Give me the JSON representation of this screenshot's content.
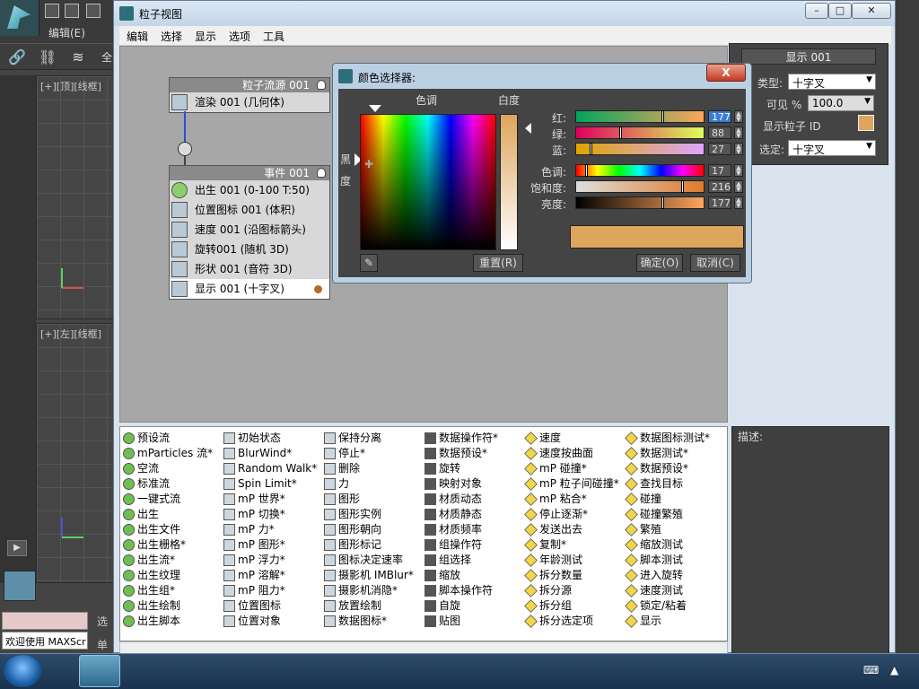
{
  "max": {
    "menu_edit": "编辑(E)",
    "viewport_top_label": "[+][顶][线框]",
    "viewport_left_label": "[+][左][线框]",
    "welcome": "欢迎使用 MAXScr",
    "status_field": "",
    "right_labels": {
      "select_stub": "选",
      "single_stub": "单"
    },
    "toolbar_stub": "全"
  },
  "particle_view": {
    "title": "粒子视图",
    "menu": [
      "编辑",
      "选择",
      "显示",
      "选项",
      "工具"
    ],
    "source_node": {
      "header": "粒子流源 001",
      "ops": [
        "渲染 001 (几何体)"
      ]
    },
    "event_node": {
      "header": "事件 001",
      "ops": [
        "出生 001 (0-100 T:50)",
        "位置图标 001 (体积)",
        "速度 001 (沿图标箭头)",
        "旋转001 (随机 3D)",
        "形状 001 (音符 3D)",
        "显示 001 (十字叉)"
      ]
    },
    "depot": {
      "col1": [
        "预设流",
        "mParticles 流*",
        "空流",
        "标准流",
        "一键式流",
        "出生",
        "出生文件",
        "出生栅格*",
        "出生流*",
        "出生纹理",
        "出生组*",
        "出生绘制",
        "出生脚本"
      ],
      "col2": [
        "初始状态",
        "BlurWind*",
        "Random Walk*",
        "Spin Limit*",
        "mP 世界*",
        "mP 切换*",
        "mP 力*",
        "mP 图形*",
        "mP 浮力*",
        "mP 溶解*",
        "mP 阻力*",
        "位置图标",
        "位置对象"
      ],
      "col3": [
        "保持分离",
        "停止*",
        "删除",
        "力",
        "图形",
        "图形实例",
        "图形朝向",
        "图形标记",
        "图标决定速率",
        "摄影机 IMBlur*",
        "摄影机消隐*",
        "放置绘制",
        "数据图标*"
      ],
      "col4": [
        "数据操作符*",
        "数据预设*",
        "旋转",
        "映射对象",
        "材质动态",
        "材质静态",
        "材质频率",
        "组操作符",
        "组选择",
        "缩放",
        "脚本操作符",
        "自旋",
        "贴图"
      ],
      "col5": [
        "速度",
        "速度按曲面",
        "mP 碰撞*",
        "mP 粒子间碰撞*",
        "mP 粘合*",
        "停止逐渐*",
        "发送出去",
        "复制*",
        "年龄测试",
        "拆分数量",
        "拆分源",
        "拆分组",
        "拆分选定项"
      ],
      "col6": [
        "数据图标测试*",
        "数据测试*",
        "数据预设*",
        "查找目标",
        "碰撞",
        "碰撞繁殖",
        "繁殖",
        "缩放测试",
        "脚本测试",
        "进入旋转",
        "速度测试",
        "锁定/粘着",
        "显示"
      ]
    },
    "description_label": "描述:"
  },
  "display_panel": {
    "title": "显示 001",
    "type_label": "类型:",
    "type_value": "十字叉",
    "visible_label": "可见 %",
    "visible_value": "100.0",
    "show_id_label": "显示粒子 ID",
    "selected_label": "选定:",
    "selected_value": "十字叉",
    "swatch_color": "#dea55c"
  },
  "color_picker": {
    "title": "颜色选择器:",
    "close_label": "X",
    "hue_label": "色调",
    "whiteness_label": "白度",
    "black_label_1": "黑",
    "black_label_2": "度",
    "red_label": "红:",
    "red_value": "177",
    "green_label": "绿:",
    "green_value": "88",
    "blue_label": "蓝:",
    "blue_value": "27",
    "hue_value_label": "色调:",
    "hue_value": "17",
    "sat_label": "饱和度:",
    "sat_value": "216",
    "val_label": "亮度:",
    "val_value": "177",
    "reset_label": "重置(R)",
    "ok_label": "确定(O)",
    "cancel_label": "取消(C)",
    "preview_color": "#dea55c",
    "red_level": 0.69,
    "green_level": 0.35,
    "blue_level": 0.11,
    "hue_level": 0.07,
    "sat_level": 0.85,
    "val_level": 0.69
  }
}
